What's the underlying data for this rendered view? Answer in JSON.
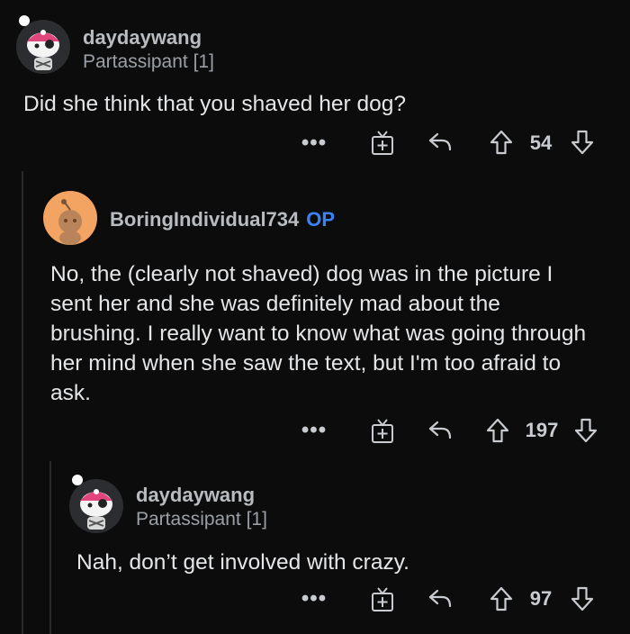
{
  "comments": [
    {
      "username": "daydaywang",
      "flair": "Partassipant [1]",
      "text": "Did she think that you shaved her dog?",
      "score": "54",
      "more": "•••"
    },
    {
      "username": "BoringIndividual734",
      "op_badge": "OP",
      "text": "No, the (clearly not shaved) dog was in the picture I sent her and she was definitely mad about the brushing. I really want to know what was going through her mind when she saw the text, but I'm too afraid to ask.",
      "score": "197",
      "more": "•••"
    },
    {
      "username": "daydaywang",
      "flair": "Partassipant [1]",
      "text": "Nah, don’t get involved with crazy.",
      "score": "97",
      "more": "•••"
    }
  ],
  "colors": {
    "background": "#0c0c0d",
    "op": "#3b82f6",
    "icon": "#c8cbcf"
  }
}
